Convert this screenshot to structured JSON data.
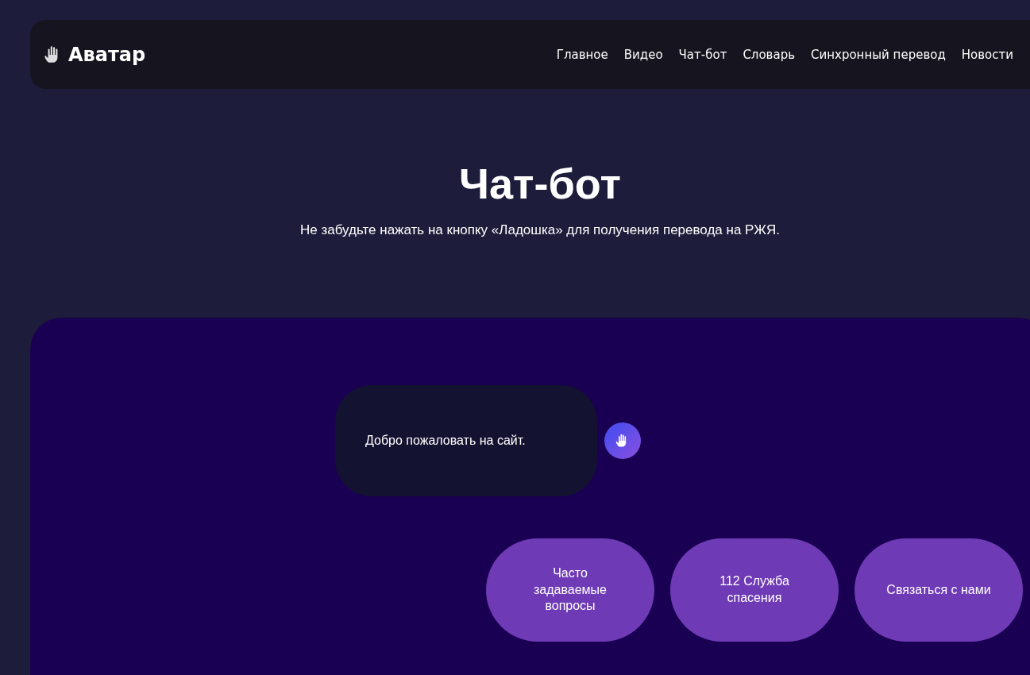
{
  "header": {
    "logo": "Аватар",
    "nav": [
      "Главное",
      "Видео",
      "Чат-бот",
      "Словарь",
      "Синхронный перевод",
      "Новости"
    ]
  },
  "hero": {
    "title": "Чат-бот",
    "subtitle": "Не забудьте нажать на кнопку «Ладошка» для получения перевода на РЖЯ."
  },
  "chat": {
    "message": "Добро пожаловать на сайт.",
    "quick_replies": [
      "Часто задаваемые вопросы",
      "112 Служба спасения",
      "Связаться с нами"
    ]
  }
}
